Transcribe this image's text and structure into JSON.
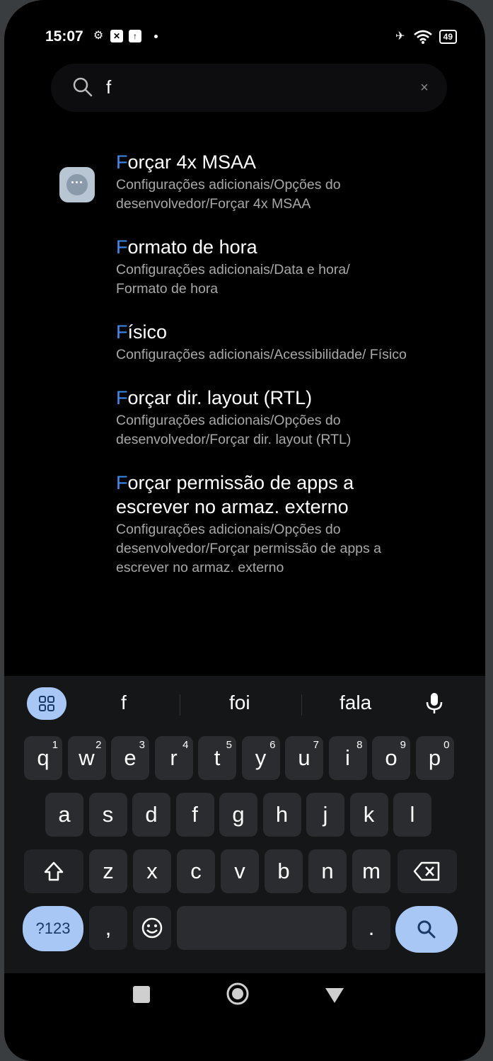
{
  "status": {
    "time": "15:07",
    "battery": "49",
    "left_icons": [
      "gear-icon",
      "x-badge-icon",
      "upload-icon"
    ],
    "right_icons": [
      "airplane-icon",
      "wifi-icon",
      "battery-icon"
    ]
  },
  "search": {
    "query": "f",
    "clear": "×"
  },
  "results": [
    {
      "hl": "F",
      "rest": "orçar 4x MSAA",
      "path": "Configurações adicionais/Opções do desenvolvedor/Forçar 4x MSAA"
    },
    {
      "hl": "F",
      "rest": "ormato de hora",
      "path": "Configurações adicionais/Data e hora/ Formato de hora"
    },
    {
      "hl": "F",
      "rest": "ísico",
      "path": "Configurações adicionais/Acessibilidade/ Físico"
    },
    {
      "hl": "F",
      "rest": "orçar dir. layout (RTL)",
      "path": "Configurações adicionais/Opções do desenvolvedor/Forçar dir. layout (RTL)"
    },
    {
      "hl": "F",
      "rest": "orçar permissão de apps a escrever no armaz. externo",
      "path": "Configurações adicionais/Opções do desenvolvedor/Forçar permissão de apps a escrever no armaz. externo"
    }
  ],
  "keyboard": {
    "suggestions": [
      "f",
      "foi",
      "fala"
    ],
    "row1": [
      {
        "k": "q",
        "n": "1"
      },
      {
        "k": "w",
        "n": "2"
      },
      {
        "k": "e",
        "n": "3"
      },
      {
        "k": "r",
        "n": "4"
      },
      {
        "k": "t",
        "n": "5"
      },
      {
        "k": "y",
        "n": "6"
      },
      {
        "k": "u",
        "n": "7"
      },
      {
        "k": "i",
        "n": "8"
      },
      {
        "k": "o",
        "n": "9"
      },
      {
        "k": "p",
        "n": "0"
      }
    ],
    "row2": [
      "a",
      "s",
      "d",
      "f",
      "g",
      "h",
      "j",
      "k",
      "l"
    ],
    "row3": [
      "z",
      "x",
      "c",
      "v",
      "b",
      "n",
      "m"
    ],
    "symbols_label": "?123",
    "comma": ",",
    "period": "."
  },
  "colors": {
    "highlight": "#3f8cf0",
    "accent_key": "#a8c7f5"
  }
}
